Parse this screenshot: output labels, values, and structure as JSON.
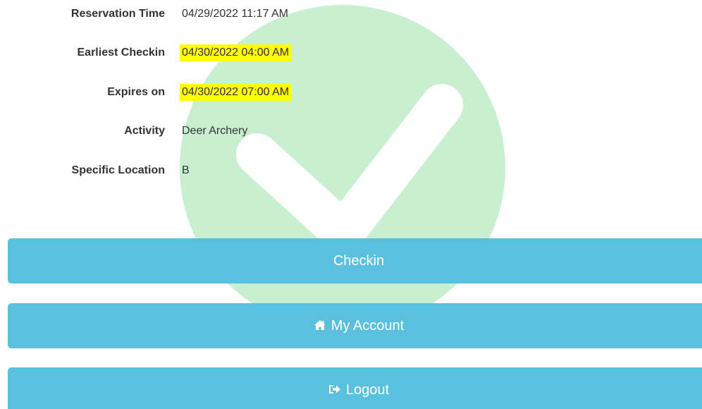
{
  "details": [
    {
      "label": "Reservation Time",
      "value": "04/29/2022 11:17 AM",
      "highlighted": false
    },
    {
      "label": "Earliest Checkin",
      "value": "04/30/2022 04:00 AM",
      "highlighted": true
    },
    {
      "label": "Expires on",
      "value": "04/30/2022 07:00 AM",
      "highlighted": true
    },
    {
      "label": "Activity",
      "value": "Deer Archery",
      "highlighted": false
    },
    {
      "label": "Specific Location",
      "value": "B",
      "highlighted": false
    }
  ],
  "buttons": {
    "checkin": {
      "label": "Checkin"
    },
    "my_account": {
      "label": "My Account",
      "icon": "home-icon"
    },
    "logout": {
      "label": "Logout",
      "icon": "sign-out-icon"
    }
  },
  "colors": {
    "button": "#5bc0de",
    "highlight": "#ffff00",
    "check_circle": "#c8efd0"
  },
  "watermark_icon": "check-circle-icon"
}
